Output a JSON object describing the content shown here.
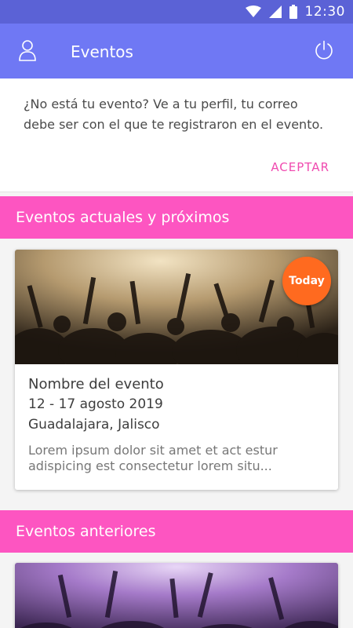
{
  "status_bar": {
    "time": "12:30",
    "icons": [
      "wifi-icon",
      "signal-icon",
      "battery-icon"
    ]
  },
  "app_bar": {
    "title": "Eventos",
    "left_icon": "user-icon",
    "right_icon": "power-icon",
    "color": "#6f78f4"
  },
  "notice": {
    "message": "¿No está tu evento? Ve a tu perfil, tu correo debe ser con el que te registraron en el evento.",
    "accept_label": "ACEPTAR"
  },
  "sections": {
    "current": {
      "title": "Eventos actuales y próximos",
      "events": [
        {
          "badge": "Today",
          "name": "Nombre del evento",
          "date": "12 - 17 agosto 2019",
          "place": "Guadalajara, Jalisco",
          "description": "Lorem ipsum dolor sit amet et act estur adispicing est consectetur lorem situ..."
        }
      ]
    },
    "past": {
      "title": "Eventos anteriores"
    }
  },
  "colors": {
    "status_bar": "#5b62d6",
    "section_header": "#fd55c1",
    "accent_link": "#f04bb0",
    "badge": "#ff6a1f"
  }
}
